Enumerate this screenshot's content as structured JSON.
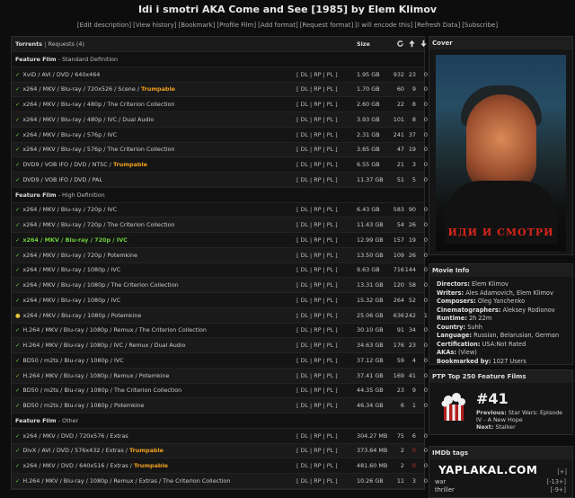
{
  "page": {
    "title_prefix": "Idi i smotri AKA Come and See [1985] by ",
    "title_director": "Elem Klimov",
    "links": [
      "[Edit description]",
      "[View history]",
      "[Bookmark]",
      "[Profile Film]",
      "[Add format]",
      "[Request format]",
      "[I will encode this]",
      "[Refresh Data]",
      "[Subscribe]"
    ]
  },
  "torrents": {
    "header_label": "Torrents",
    "requests_label": "Requests (4)",
    "size_label": "Size",
    "icons": [
      "snatched-icon",
      "seeders-up-icon",
      "leechers-down-icon"
    ],
    "sections": [
      {
        "label": "Feature Film",
        "sub": "- Standard Definition",
        "rows": [
          {
            "status": "check",
            "text": "XviD / AVI / DVD / 640x464",
            "hl": "",
            "dl": "[ DL | RP | PL ]",
            "size": "1.95 GB",
            "s": "932",
            "u": "23",
            "d": "0",
            "style": ""
          },
          {
            "status": "check",
            "text": "x264 / MKV / Blu-ray / 720x526 / Scene / ",
            "hl": "Trumpable",
            "dl": "[ DL | RP | PL ]",
            "size": "1.70 GB",
            "s": "60",
            "u": "9",
            "d": "0",
            "style": ""
          },
          {
            "status": "check",
            "text": "x264 / MKV / Blu-ray / 480p / The Criterion Collection",
            "hl": "",
            "dl": "[ DL | RP | PL ]",
            "size": "2.60 GB",
            "s": "22",
            "u": "8",
            "d": "0",
            "style": ""
          },
          {
            "status": "check",
            "text": "x264 / MKV / Blu-ray / 480p / IVC / Dual Audio",
            "hl": "",
            "dl": "[ DL | RP | PL ]",
            "size": "3.93 GB",
            "s": "101",
            "u": "8",
            "d": "0",
            "style": ""
          },
          {
            "status": "check",
            "text": "x264 / MKV / Blu-ray / 576p / IVC",
            "hl": "",
            "dl": "[ DL | RP | PL ]",
            "size": "2.31 GB",
            "s": "241",
            "u": "37",
            "d": "0",
            "style": ""
          },
          {
            "status": "check",
            "text": "x264 / MKV / Blu-ray / 576p / The Criterion Collection",
            "hl": "",
            "dl": "[ DL | RP | PL ]",
            "size": "3.65 GB",
            "s": "47",
            "u": "19",
            "d": "0",
            "style": ""
          },
          {
            "status": "check",
            "text": "DVD9 / VOB IFO / DVD / NTSC / ",
            "hl": "Trumpable",
            "dl": "[ DL | RP | PL ]",
            "size": "6.55 GB",
            "s": "21",
            "u": "3",
            "d": "0",
            "style": ""
          },
          {
            "status": "check",
            "text": "DVD9 / VOB IFO / DVD / PAL",
            "hl": "",
            "dl": "[ DL | RP | PL ]",
            "size": "11.37 GB",
            "s": "51",
            "u": "5",
            "d": "0",
            "style": ""
          }
        ]
      },
      {
        "label": "Feature Film",
        "sub": "- High Definition",
        "rows": [
          {
            "status": "check",
            "text": "x264 / MKV / Blu-ray / 720p / IVC",
            "hl": "",
            "dl": "[ DL | RP | PL ]",
            "size": "6.43 GB",
            "s": "583",
            "u": "90",
            "d": "0",
            "style": ""
          },
          {
            "status": "check",
            "text": "x264 / MKV / Blu-ray / 720p / The Criterion Collection",
            "hl": "",
            "dl": "[ DL | RP | PL ]",
            "size": "11.43 GB",
            "s": "54",
            "u": "26",
            "d": "0",
            "style": ""
          },
          {
            "status": "check",
            "text": "x264 / MKV / Blu-ray / 720p / IVC",
            "hl": "",
            "dl": "[ DL | RP | PL ]",
            "size": "12.99 GB",
            "s": "157",
            "u": "19",
            "d": "0",
            "style": "green"
          },
          {
            "status": "check",
            "text": "x264 / MKV / Blu-ray / 720p / Potemkine",
            "hl": "",
            "dl": "[ DL | RP | PL ]",
            "size": "13.50 GB",
            "s": "109",
            "u": "26",
            "d": "0",
            "style": ""
          },
          {
            "status": "check",
            "text": "x264 / MKV / Blu-ray / 1080p / IVC",
            "hl": "",
            "dl": "[ DL | RP | PL ]",
            "size": "9.63 GB",
            "s": "716",
            "u": "144",
            "d": "0",
            "style": ""
          },
          {
            "status": "check",
            "text": "x264 / MKV / Blu-ray / 1080p / The Criterion Collection",
            "hl": "",
            "dl": "[ DL | RP | PL ]",
            "size": "13.31 GB",
            "s": "120",
            "u": "58",
            "d": "0",
            "style": ""
          },
          {
            "status": "check",
            "text": "x264 / MKV / Blu-ray / 1080p / IVC",
            "hl": "",
            "dl": "[ DL | RP | PL ]",
            "size": "15.32 GB",
            "s": "264",
            "u": "52",
            "d": "0",
            "style": ""
          },
          {
            "status": "warn",
            "text": "x264 / MKV / Blu-ray / 1080p / Potemkine",
            "hl": "",
            "dl": "[ DL | RP | PL ]",
            "size": "25.06 GB",
            "s": "636",
            "u": "242",
            "d": "1",
            "style": ""
          },
          {
            "status": "check",
            "text": "H.264 / MKV / Blu-ray / 1080p / Remux / The Criterion Collection",
            "hl": "",
            "dl": "[ DL | RP | PL ]",
            "size": "30.10 GB",
            "s": "91",
            "u": "34",
            "d": "0",
            "style": ""
          },
          {
            "status": "check",
            "text": "H.264 / MKV / Blu-ray / 1080p / IVC / Remux / Dual Audio",
            "hl": "",
            "dl": "[ DL | RP | PL ]",
            "size": "34.63 GB",
            "s": "176",
            "u": "23",
            "d": "0",
            "style": ""
          },
          {
            "status": "check",
            "text": "BD50 / m2ts / Blu-ray / 1080p / IVC",
            "hl": "",
            "dl": "[ DL | RP | PL ]",
            "size": "37.12 GB",
            "s": "59",
            "u": "4",
            "d": "0",
            "style": ""
          },
          {
            "status": "check",
            "text": "H.264 / MKV / Blu-ray / 1080p / Remux / Potemkine",
            "hl": "",
            "dl": "[ DL | RP | PL ]",
            "size": "37.41 GB",
            "s": "169",
            "u": "41",
            "d": "0",
            "style": ""
          },
          {
            "status": "check",
            "text": "BD50 / m2ts / Blu-ray / 1080p / The Criterion Collection",
            "hl": "",
            "dl": "[ DL | RP | PL ]",
            "size": "44.35 GB",
            "s": "23",
            "u": "9",
            "d": "0",
            "style": ""
          },
          {
            "status": "check",
            "text": "BD50 / m2ts / Blu-ray / 1080p / Potemkine",
            "hl": "",
            "dl": "[ DL | RP | PL ]",
            "size": "46.34 GB",
            "s": "6",
            "u": "1",
            "d": "0",
            "style": ""
          }
        ]
      },
      {
        "label": "Feature Film",
        "sub": "- Other",
        "rows": [
          {
            "status": "check",
            "text": "x264 / MKV / DVD / 720x576 / Extras",
            "hl": "",
            "dl": "[ DL | RP | PL ]",
            "size": "304.27 MB",
            "s": "75",
            "u": "6",
            "d": "0",
            "style": ""
          },
          {
            "status": "check",
            "text": "DivX / AVI / DVD / 576x432 / Extras / ",
            "hl": "Trumpable",
            "dl": "[ DL | RP | PL ]",
            "size": "373.64 MB",
            "s": "2",
            "u": "0",
            "d": "0",
            "style": "redu"
          },
          {
            "status": "check",
            "text": "x264 / MKV / DVD / 640x516 / Extras / ",
            "hl": "Trumpable",
            "dl": "[ DL | RP | PL ]",
            "size": "481.60 MB",
            "s": "2",
            "u": "0",
            "d": "0",
            "style": "redu"
          },
          {
            "status": "check",
            "text": "H.264 / MKV / Blu-ray / 1080p / Remux / Extras / The Criterion Collection",
            "hl": "",
            "dl": "[ DL | RP | PL ]",
            "size": "10.26 GB",
            "s": "11",
            "u": "3",
            "d": "0",
            "style": ""
          }
        ]
      }
    ]
  },
  "cover": {
    "header": "Cover",
    "poster_title": "ИДИ И СМОТРИ"
  },
  "movie_info": {
    "header": "Movie Info",
    "lines": [
      {
        "k": "Directors:",
        "v": " Elem Klimov"
      },
      {
        "k": "Writers:",
        "v": " Ales Adamovich, Elem Klimov"
      },
      {
        "k": "Composers:",
        "v": " Oleg Yanchenko"
      },
      {
        "k": "Cinematographers:",
        "v": " Aleksey Rodionov"
      },
      {
        "k": "Runtime:",
        "v": " 2h 22m"
      },
      {
        "k": "Country:",
        "v": " Suhh"
      },
      {
        "k": "Language:",
        "v": " Russian, Belarusian, German"
      },
      {
        "k": "Certification:",
        "v": " USA:Not Rated"
      },
      {
        "k": "AKAs:",
        "v": " (View)"
      },
      {
        "k": "Bookmarked by:",
        "v": " 1027 Users"
      }
    ]
  },
  "top250": {
    "header": "PTP Top 250 Feature Films",
    "rank": "#41",
    "previous_label": "Previous:",
    "previous": " Star Wars: Episode IV - A New Hope",
    "next_label": "Next:",
    "next": " Stalker"
  },
  "imdb_tags": {
    "header": "IMDb tags",
    "tags": [
      {
        "name": "war",
        "votes": "[-13+]"
      },
      {
        "name": "thriller",
        "votes": "[-9+]"
      }
    ],
    "top_votes": "[+]"
  },
  "watermark": "YAPLAKAL.COM"
}
